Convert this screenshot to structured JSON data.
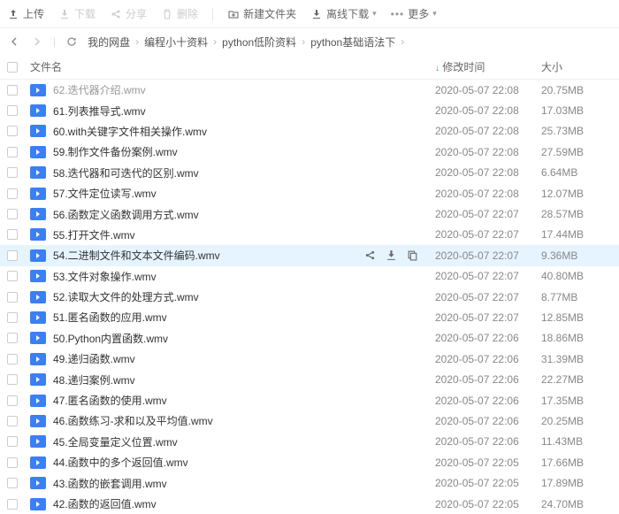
{
  "toolbar": {
    "upload": "上传",
    "download": "下载",
    "share": "分享",
    "delete": "删除",
    "new_folder": "新建文件夹",
    "offline_download": "离线下载",
    "more": "更多"
  },
  "breadcrumb": {
    "items": [
      "我的网盘",
      "编程小十资料",
      "python低阶资料",
      "python基础语法下"
    ]
  },
  "columns": {
    "name": "文件名",
    "time": "修改时间",
    "size": "大小"
  },
  "files": [
    {
      "name": "62.迭代器介绍.wmv",
      "time": "2020-05-07 22:08",
      "size": "20.75MB",
      "cut": true
    },
    {
      "name": "61.列表推导式.wmv",
      "time": "2020-05-07 22:08",
      "size": "17.03MB"
    },
    {
      "name": "60.with关键字文件相关操作.wmv",
      "time": "2020-05-07 22:08",
      "size": "25.73MB"
    },
    {
      "name": "59.制作文件备份案例.wmv",
      "time": "2020-05-07 22:08",
      "size": "27.59MB"
    },
    {
      "name": "58.迭代器和可迭代的区别.wmv",
      "time": "2020-05-07 22:08",
      "size": "6.64MB"
    },
    {
      "name": "57.文件定位读写.wmv",
      "time": "2020-05-07 22:08",
      "size": "12.07MB"
    },
    {
      "name": "56.函数定义函数调用方式.wmv",
      "time": "2020-05-07 22:07",
      "size": "28.57MB"
    },
    {
      "name": "55.打开文件.wmv",
      "time": "2020-05-07 22:07",
      "size": "17.44MB"
    },
    {
      "name": "54.二进制文件和文本文件编码.wmv",
      "time": "2020-05-07 22:07",
      "size": "9.36MB",
      "selected": true
    },
    {
      "name": "53.文件对象操作.wmv",
      "time": "2020-05-07 22:07",
      "size": "40.80MB"
    },
    {
      "name": "52.读取大文件的处理方式.wmv",
      "time": "2020-05-07 22:07",
      "size": "8.77MB"
    },
    {
      "name": "51.匿名函数的应用.wmv",
      "time": "2020-05-07 22:07",
      "size": "12.85MB"
    },
    {
      "name": "50.Python内置函数.wmv",
      "time": "2020-05-07 22:06",
      "size": "18.86MB"
    },
    {
      "name": "49.递归函数.wmv",
      "time": "2020-05-07 22:06",
      "size": "31.39MB"
    },
    {
      "name": "48.递归案例.wmv",
      "time": "2020-05-07 22:06",
      "size": "22.27MB"
    },
    {
      "name": "47.匿名函数的使用.wmv",
      "time": "2020-05-07 22:06",
      "size": "17.35MB"
    },
    {
      "name": "46.函数练习-求和以及平均值.wmv",
      "time": "2020-05-07 22:06",
      "size": "20.25MB"
    },
    {
      "name": "45.全局变量定义位置.wmv",
      "time": "2020-05-07 22:06",
      "size": "11.43MB"
    },
    {
      "name": "44.函数中的多个返回值.wmv",
      "time": "2020-05-07 22:05",
      "size": "17.66MB"
    },
    {
      "name": "43.函数的嵌套调用.wmv",
      "time": "2020-05-07 22:05",
      "size": "17.89MB"
    },
    {
      "name": "42.函数的返回值.wmv",
      "time": "2020-05-07 22:05",
      "size": "24.70MB"
    }
  ]
}
